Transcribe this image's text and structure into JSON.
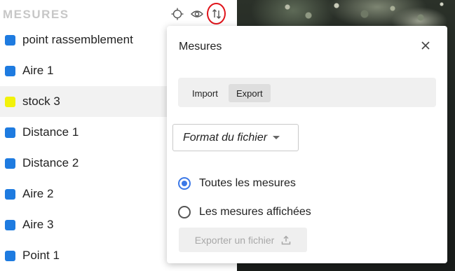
{
  "panel": {
    "title": "MESURES",
    "header_icons": [
      "locate-icon",
      "eye-icon",
      "import-export-icon"
    ],
    "items": [
      {
        "label": "point rassemblement",
        "color": "#1e7be0",
        "selected": false
      },
      {
        "label": "Aire 1",
        "color": "#1e7be0",
        "selected": false
      },
      {
        "label": "stock 3",
        "color": "#f2f20a",
        "selected": true
      },
      {
        "label": "Distance 1",
        "color": "#1e7be0",
        "selected": false
      },
      {
        "label": "Distance 2",
        "color": "#1e7be0",
        "selected": false
      },
      {
        "label": "Aire 2",
        "color": "#1e7be0",
        "selected": false
      },
      {
        "label": "Aire 3",
        "color": "#1e7be0",
        "selected": false
      },
      {
        "label": "Point 1",
        "color": "#1e7be0",
        "selected": false
      }
    ]
  },
  "dialog": {
    "title": "Mesures",
    "close_icon": "close-icon",
    "tabs": [
      {
        "label": "Import",
        "active": false
      },
      {
        "label": "Export",
        "active": true
      }
    ],
    "format_dropdown": {
      "label": "Format du fichier"
    },
    "options": [
      {
        "label": "Toutes les mesures",
        "checked": true
      },
      {
        "label": "Les mesures affichées",
        "checked": false
      }
    ],
    "export_button": {
      "label": "Exporter un fichier",
      "icon": "upload-icon",
      "disabled": true
    }
  },
  "colors": {
    "accent_red": "#d81920",
    "radio_blue": "#3b78e7"
  }
}
